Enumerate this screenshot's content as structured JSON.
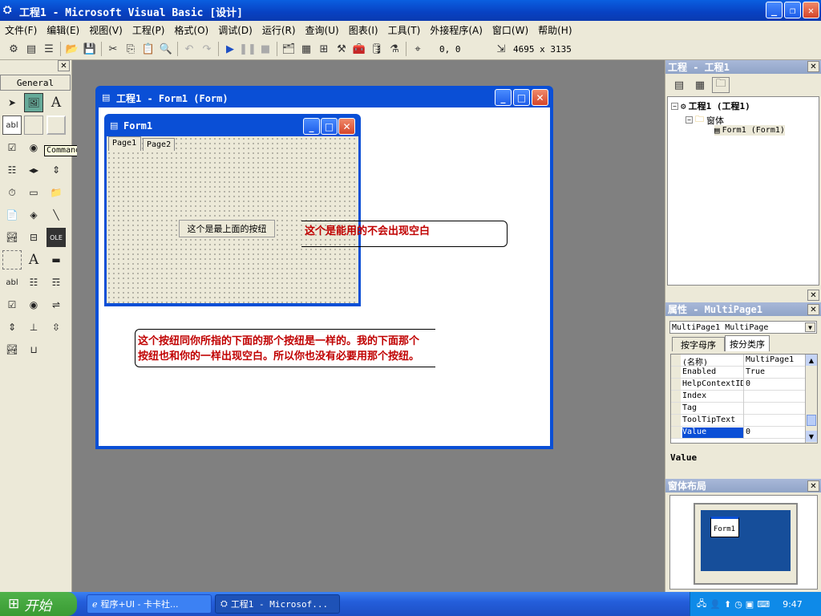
{
  "app": {
    "title": "工程1 - Microsoft Visual Basic [设计]"
  },
  "menu": [
    "文件(F)",
    "编辑(E)",
    "视图(V)",
    "工程(P)",
    "格式(O)",
    "调试(D)",
    "运行(R)",
    "查询(U)",
    "图表(I)",
    "工具(T)",
    "外接程序(A)",
    "窗口(W)",
    "帮助(H)"
  ],
  "toolbar": {
    "position": "0, 0",
    "size": "4695 x 3135"
  },
  "toolbox": {
    "tab": "General",
    "tooltip": "CommandButton"
  },
  "designer": {
    "outer_title": "工程1 - Form1 (Form)",
    "inner_title": "Form1",
    "tabs": [
      "Page1",
      "Page2"
    ],
    "button_label": "这个是最上面的按纽"
  },
  "notes": {
    "note1": "这个是能用的不会出现空白",
    "note2_line1": "这个按纽同你所指的下面的那个按纽是一样的。我的下面那个",
    "note2_line2": "按纽也和你的一样出现空白。所以你也没有必要用那个按纽。"
  },
  "project": {
    "title": "工程 - 工程1",
    "root": "工程1 (工程1)",
    "folder": "窗体",
    "form": "Form1 (Form1)"
  },
  "properties": {
    "title": "属性 - MultiPage1",
    "object": "MultiPage1 MultiPage",
    "tabs": [
      "按字母序",
      "按分类序"
    ],
    "rows": [
      {
        "name": "(名称)",
        "value": "MultiPage1"
      },
      {
        "name": "Enabled",
        "value": "True"
      },
      {
        "name": "HelpContextID",
        "value": "0"
      },
      {
        "name": "Index",
        "value": ""
      },
      {
        "name": "Tag",
        "value": ""
      },
      {
        "name": "ToolTipText",
        "value": ""
      },
      {
        "name": "Value",
        "value": "0"
      }
    ],
    "desc": "Value"
  },
  "layout": {
    "title": "窗体布局",
    "form_label": "Form1"
  },
  "taskbar": {
    "start": "开始",
    "task1": "程序+UI - 卡卡社...",
    "task2": "工程1 - Microsof...",
    "clock": "9:47"
  }
}
